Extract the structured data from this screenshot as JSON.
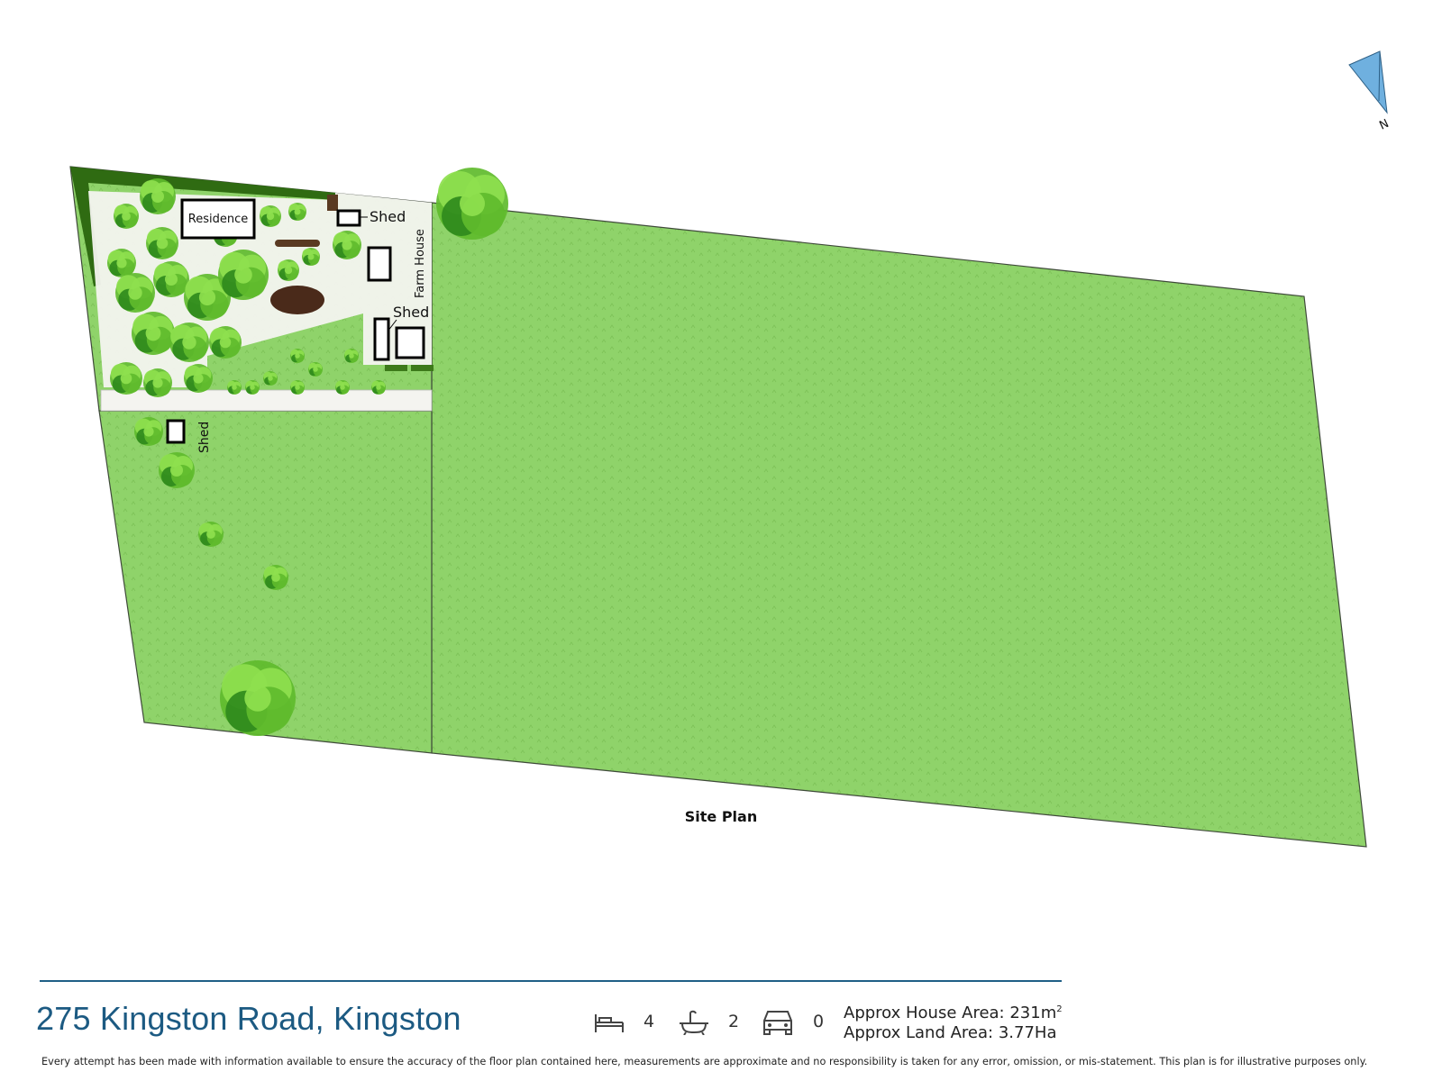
{
  "map": {
    "compass_label": "N",
    "caption": "Site Plan",
    "labels": {
      "residence": "Residence",
      "shed_top": "Shed",
      "farm_house": "Farm House",
      "shed_middle": "Shed",
      "shed_lower": "Shed"
    },
    "colors": {
      "lawn": "#8fd36a",
      "lawn_stroke": "#3f4a3a",
      "tree_light": "#8ee04e",
      "tree_mid": "#5fbb2c",
      "tree_dark": "#2f8a1c",
      "hedge": "#2f6b12",
      "courtyard": "#f4f4f0",
      "compass": "#6fb0df"
    }
  },
  "footer": {
    "address": "275 Kingston Road, Kingston",
    "bedrooms": {
      "icon": "bed-icon",
      "count": "4"
    },
    "bathrooms": {
      "icon": "bath-icon",
      "count": "2"
    },
    "car_spaces": {
      "icon": "car-icon",
      "count": "0"
    },
    "house_area_label": "Approx House Area: 231m",
    "house_area_superscript": "2",
    "land_area": "Approx Land Area: 3.77Ha",
    "disclaimer": "Every attempt has been made with information available to ensure the accuracy of the floor plan contained here, measurements are approximate and no responsibility is taken for any error, omission, or mis-statement. This plan is for illustrative purposes only.",
    "accent_color": "#1c5a82"
  }
}
